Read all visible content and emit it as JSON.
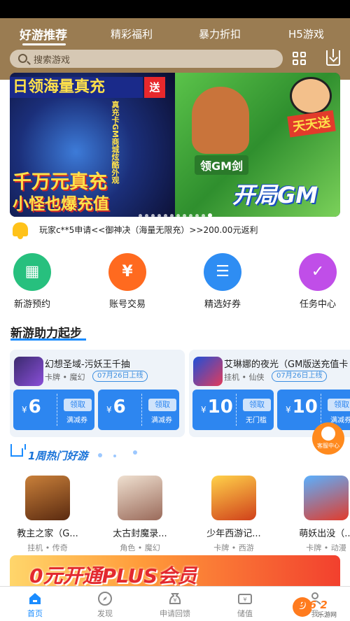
{
  "top_tabs": [
    {
      "label": "好游推荐",
      "active": true
    },
    {
      "label": "精彩福利",
      "active": false
    },
    {
      "label": "暴力折扣",
      "active": false
    },
    {
      "label": "H5游戏",
      "active": false
    }
  ],
  "search": {
    "placeholder": "搜索游戏",
    "icon": "search-icon"
  },
  "header_icons": [
    "grid-icon",
    "download-icon"
  ],
  "banner": {
    "slide1_top": "日领海量真充",
    "slide1_badge": "送",
    "slide1_side": "真充卡GM商城炫酷外观",
    "slide1_big1": "千万元真充",
    "slide1_big2": "小怪也爆充值",
    "slide2_gm_small": "领GM剑",
    "slide2_gm_big": "开局GM",
    "slide2_corner": "天天送",
    "dots_total": 12,
    "active_dot": 11
  },
  "notice": {
    "icon": "bell-icon",
    "text": "玩家c**5申请<<御神决（海量无限充）>>200.00元返利"
  },
  "quick_entries": [
    {
      "label": "新游预约",
      "color": "#27c07e",
      "glyph": "📅"
    },
    {
      "label": "账号交易",
      "color": "#ff6a1f",
      "glyph": "¥"
    },
    {
      "label": "精选好券",
      "color": "#2e8df3",
      "glyph": "☰"
    },
    {
      "label": "任务中心",
      "color": "#c04ee8",
      "glyph": "✓"
    }
  ],
  "section_title": "新游助力起步",
  "new_games": [
    {
      "name": "幻想圣域-污妖王千抽",
      "tags": "卡牌 • 魔幻",
      "date": "07月26日上线",
      "coupons": [
        {
          "currency": "¥",
          "amount": "6",
          "button": "领取",
          "type": "满减券"
        },
        {
          "currency": "¥",
          "amount": "6",
          "button": "领取",
          "type": "满减券"
        }
      ]
    },
    {
      "name": "艾琳娜的夜光（GM版送充值卡",
      "tags": "挂机 • 仙侠",
      "date": "07月26日上线",
      "coupons": [
        {
          "currency": "¥",
          "amount": "10",
          "button": "领取",
          "type": "无门槛"
        },
        {
          "currency": "¥",
          "amount": "10",
          "button": "领取",
          "type": "满减券"
        }
      ]
    }
  ],
  "service": {
    "label": "客服中心"
  },
  "hot_title": "1周热门好游",
  "hot_games": [
    {
      "name": "教主之家（G...",
      "tags": "挂机 • 传奇",
      "color": "#8b4a1f"
    },
    {
      "name": "太古封魔录...",
      "tags": "角色 • 魔幻",
      "color": "#c9a98a"
    },
    {
      "name": "少年西游记...",
      "tags": "卡牌 • 西游",
      "color": "#e8842a"
    },
    {
      "name": "萌妖出没（...",
      "tags": "卡牌 • 动漫",
      "color": "#3b7ad6"
    }
  ],
  "promo_banner": "0元开通PLUS会员",
  "bottom_tabs": [
    {
      "label": "首页",
      "icon": "home-icon",
      "active": true
    },
    {
      "label": "发现",
      "icon": "compass-icon",
      "active": false
    },
    {
      "label": "申请回馈",
      "icon": "money-bag-icon",
      "active": false
    },
    {
      "label": "储值",
      "icon": "ticket-icon",
      "active": false
    },
    {
      "label": "我",
      "icon": "user-icon",
      "active": false
    }
  ],
  "watermark": {
    "text": "9 6 2",
    "sub": "乐游网"
  },
  "colors": {
    "header": "#9a7c52",
    "accent": "#1a8cff",
    "coupon": "#2d86f0",
    "service": "#ff8a1e"
  }
}
